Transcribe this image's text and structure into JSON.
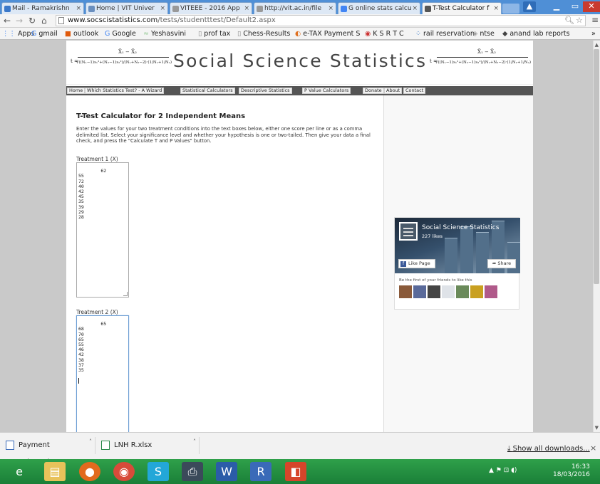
{
  "browser": {
    "tabs": [
      {
        "label": "Mail - Ramakrishn",
        "favicon_color": "#3a78c9"
      },
      {
        "label": "Home | VIT Univer",
        "favicon_color": "#6a8fbf"
      },
      {
        "label": "VITEEE - 2016 App",
        "favicon_color": "#999999"
      },
      {
        "label": "http://vit.ac.in/file",
        "favicon_color": "#999999"
      },
      {
        "label": "G online stats calcu",
        "favicon_color": "#4285f4"
      },
      {
        "label": "T-Test Calculator f",
        "favicon_color": "#555555",
        "active": true
      }
    ],
    "url_host": "www.socscistatistics.com",
    "url_path": "/tests/studentttest/Default2.aspx",
    "bookmarks": [
      "Apps",
      "gmail",
      "outlook",
      "Google",
      "Yeshasvini",
      "prof tax",
      "Chess-Results",
      "e-TAX Payment S",
      "K S R T C",
      "rail reservation",
      "ntse",
      "anand lab reports"
    ],
    "bookmarks_more": "»"
  },
  "site": {
    "title": "Social Science Statistics",
    "formula": {
      "lhs": "t =",
      "numerator": "X̄₁ − X̄₂",
      "denominator": "√((N₁−1)s₁²+(N₂−1)s₂²)/(N₁+N₂−2)·(1/N₁+1/N₂)"
    },
    "nav": [
      "Home",
      "Which Statistics Test? - A Wizard",
      "Statistical Calculators",
      "Descriptive Statistics",
      "P Value Calculators",
      "Donate",
      "About",
      "Contact"
    ]
  },
  "main": {
    "heading": "T-Test Calculator for 2 Independent Means",
    "intro": "Enter the values for your two treatment conditions into the text boxes below, either one score per line or as a comma delimited list. Select your significance level and whether your hypothesis is one or two-tailed. Then give your data a final check, and press the \"Calculate T and P Values\" button.",
    "treatment1_label": "Treatment 1 (X)",
    "treatment1_values": "62\n55\n72\n40\n42\n45\n35\n39\n29\n28",
    "treatment2_label": "Treatment 2 (X)",
    "treatment2_values": "65\n68\n70\n65\n55\n46\n42\n38\n37\n35"
  },
  "fb_widget": {
    "page_name": "Social Science Statistics",
    "likes": "227 likes",
    "like_button": "Like Page",
    "share_button": "Share",
    "friends_text": "Be the first of your friends to like this"
  },
  "downloads": {
    "items": [
      "Payment Ackn....docx",
      "LNH R.xlsx"
    ],
    "show_all": "Show all downloads...",
    "close": "×"
  },
  "taskbar": {
    "time": "16:33",
    "date": "18/03/2016"
  }
}
